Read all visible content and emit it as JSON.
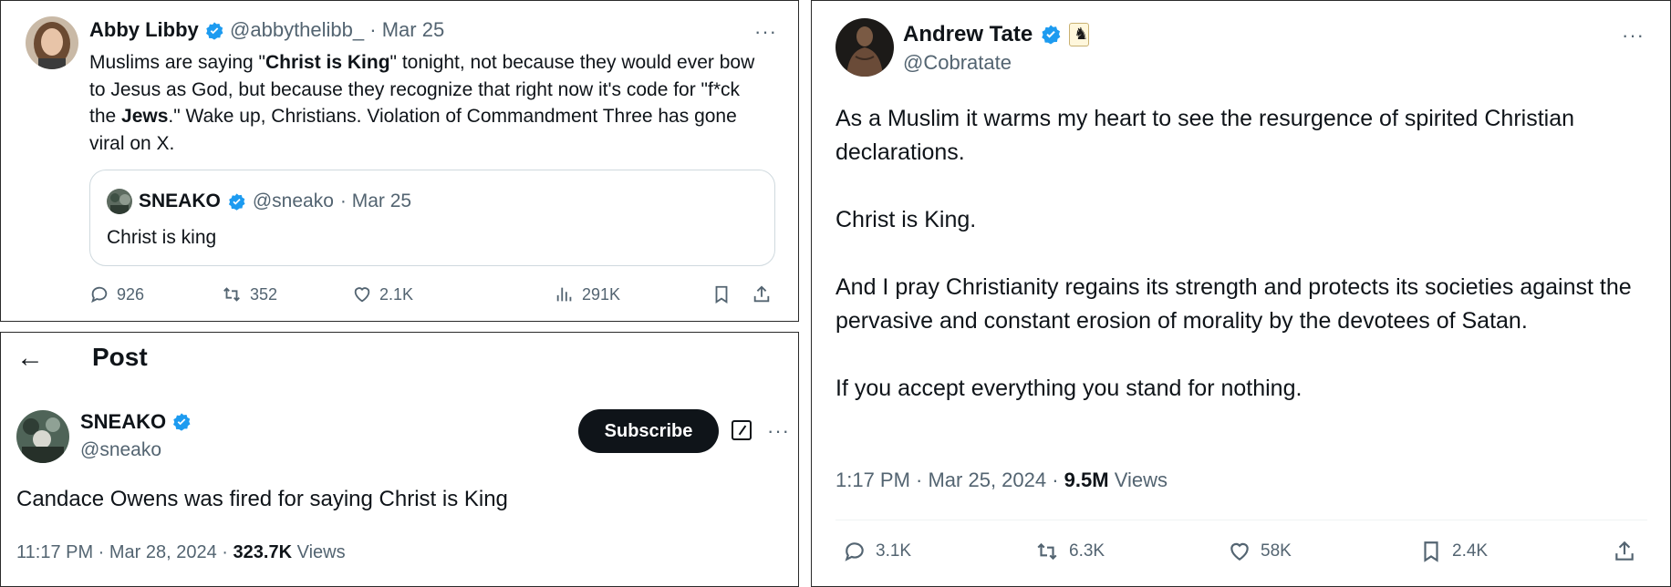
{
  "tweet_a": {
    "name": "Abby Libby",
    "handle": "@abbythelibb_",
    "date": "· Mar 25",
    "more": "···",
    "body": [
      {
        "t": "Muslims are saying \"",
        "b": false
      },
      {
        "t": "Christ is King",
        "b": true
      },
      {
        "t": "\" tonight, not because they would ever bow to Jesus as God, but because they recognize that right now it's code for \"f*ck the ",
        "b": false
      },
      {
        "t": "Jews",
        "b": true
      },
      {
        "t": ".\" Wake up, Christians. Violation of Commandment Three has gone viral on X.",
        "b": false
      }
    ],
    "quote": {
      "name": "SNEAKO",
      "handle": "@sneako",
      "date": "· Mar 25",
      "body": "Christ is king"
    },
    "stats": {
      "replies": "926",
      "reposts": "352",
      "likes": "2.1K",
      "views": "291K"
    }
  },
  "tweet_b": {
    "header_title": "Post",
    "back_glyph": "←",
    "name": "SNEAKO",
    "handle": "@sneako",
    "subscribe_label": "Subscribe",
    "more": "···",
    "body": "Candace Owens was fired for saying Christ is King",
    "timestamp": "11:17 PM · Mar 28, 2024 · ",
    "views_count": "323.7K",
    "views_label": " Views"
  },
  "tweet_c": {
    "name": "Andrew Tate",
    "handle": "@Cobratate",
    "badge_glyph": "♞",
    "more": "···",
    "paragraphs": [
      "As a Muslim it warms my heart to see the resurgence of spirited Christian declarations.",
      "Christ is King.",
      "And I pray Christianity regains its strength and protects its societies against the pervasive and constant erosion of morality by the devotees of Satan.",
      "If you accept everything you stand for nothing."
    ],
    "timestamp": "1:17 PM · Mar 25, 2024 · ",
    "views_count": "9.5M",
    "views_label": " Views",
    "stats": {
      "replies": "3.1K",
      "reposts": "6.3K",
      "likes": "58K",
      "bookmarks": "2.4K"
    }
  },
  "colors": {
    "verified": "#1d9bf0",
    "muted": "#536471",
    "text": "#0f1419",
    "border": "#cfd9de"
  },
  "icons": [
    "verified-badge-icon",
    "reply-icon",
    "repost-icon",
    "like-icon",
    "views-icon",
    "bookmark-icon",
    "share-icon",
    "back-arrow-icon",
    "edit-icon",
    "more-icon"
  ]
}
